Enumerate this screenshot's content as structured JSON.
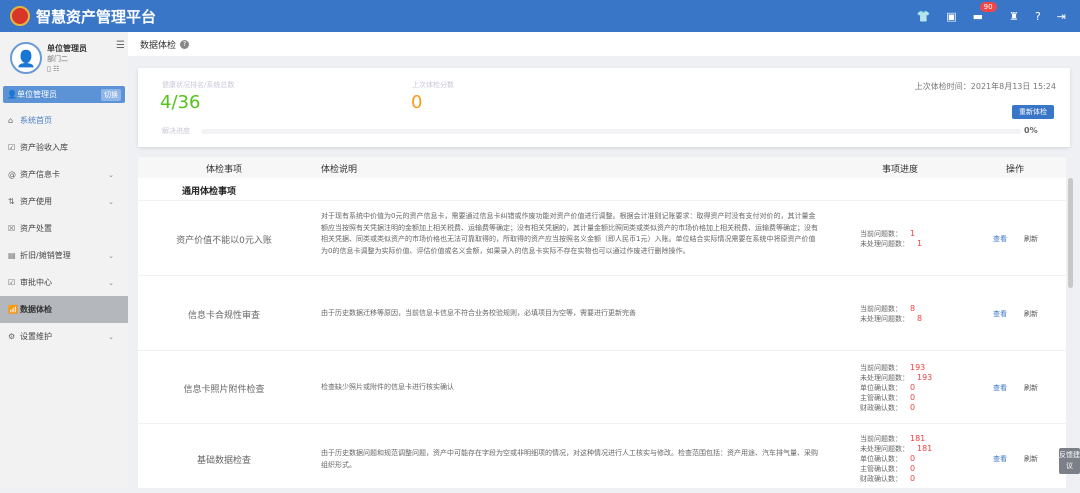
{
  "app": {
    "title": "智慧资产管理平台",
    "badge_count": "90"
  },
  "header_icons": [
    "shirt-icon",
    "archive-icon",
    "message-icon",
    "alarm-icon",
    "help-icon",
    "logout-icon"
  ],
  "user": {
    "name": "单位管理员",
    "dept": "部门二",
    "role": "单位管理员",
    "switch": "切换"
  },
  "menu": [
    {
      "label": "系统首页",
      "icon": "home-icon",
      "chev": false
    },
    {
      "label": "资产验收入库",
      "icon": "checkbox-icon",
      "chev": false
    },
    {
      "label": "资产信息卡",
      "icon": "at-icon",
      "chev": true
    },
    {
      "label": "资产使用",
      "icon": "transfer-icon",
      "chev": true
    },
    {
      "label": "资产处置",
      "icon": "dispose-icon",
      "chev": false
    },
    {
      "label": "折旧/摊销管理",
      "icon": "depreciation-icon",
      "chev": true
    },
    {
      "label": "审批中心",
      "icon": "approve-icon",
      "chev": true
    },
    {
      "label": "数据体检",
      "icon": "chart-icon",
      "chev": false
    },
    {
      "label": "设置维护",
      "icon": "settings-icon",
      "chev": true
    }
  ],
  "page": {
    "title": "数据体检"
  },
  "summary": {
    "rank_label": "健康状况排名/系统总数",
    "rank": "4/36",
    "score_label": "上次体检分数",
    "score": "0",
    "progress_label": "解决进度",
    "progress": "0%",
    "progress_value": 0,
    "last_time": "上次体检时间：2021年8月13日 15:24",
    "recheck": "重新体检"
  },
  "table": {
    "headers": [
      "体检事项",
      "体检说明",
      "事项进度",
      "操作"
    ],
    "group": "通用体检事项",
    "rows": [
      {
        "name": "资产价值不能以0元入账",
        "desc": "对于现有系统中价值为0元的资产信息卡，需要通过信息卡纠错或作废功能对资产价值进行调整。根据会计准则记账要求：取得资产时没有支付对价的，其计量金额应当按照有关凭据注明的金额加上相关税费、运输费等确定；没有相关凭据的，其计量金额比照同类或类似资产的市场价格加上相关税费、运输费等确定；没有相关凭据、同类或类似资产的市场价格也无法可靠取得的，所取得的资产应当按照名义金额（即人民币1元）入账。单位结合实际情况需要在系统中将原资产价值为0的信息卡调整为实际价值、评估价值或名义金额，如果录入的信息卡实际不存在实物也可以通过作废进行删除操作。",
        "stats": [
          [
            "当前问题数：",
            "1"
          ],
          [
            "未处理问题数：",
            "1"
          ]
        ]
      },
      {
        "name": "信息卡合规性审查",
        "desc": "由于历史数据迁移等原因，当前信息卡信息不符合业务校验规则，必填项目为空等，需要进行更新完善",
        "stats": [
          [
            "当前问题数：",
            "8"
          ],
          [
            "未处理问题数：",
            "8"
          ]
        ]
      },
      {
        "name": "信息卡照片附件检查",
        "desc": "检查缺少照片或附件的信息卡进行核实确认",
        "stats": [
          [
            "当前问题数：",
            "193"
          ],
          [
            "未处理问题数：",
            "193"
          ],
          [
            "单位确认数：",
            "0"
          ],
          [
            "主管确认数：",
            "0"
          ],
          [
            "财政确认数：",
            "0"
          ]
        ]
      },
      {
        "name": "基础数据检查",
        "desc": "由于历史数据问题和规范调整问题，资产中可能存在字段为空或非明细项的情况，对这种情况进行人工核实与修改。检查范围包括：资产用途、汽车排气量、采购组织形式。",
        "stats": [
          [
            "当前问题数：",
            "181"
          ],
          [
            "未处理问题数：",
            "181"
          ],
          [
            "单位确认数：",
            "0"
          ],
          [
            "主管确认数：",
            "0"
          ],
          [
            "财政确认数：",
            "0"
          ]
        ]
      }
    ],
    "view": "查看",
    "refresh": "刷新"
  },
  "feedback": "反馈建议",
  "colors": {
    "brand": "#3a76c8",
    "rank": "#52c41a",
    "score": "#fa9a1c",
    "issue": "#f04040"
  }
}
